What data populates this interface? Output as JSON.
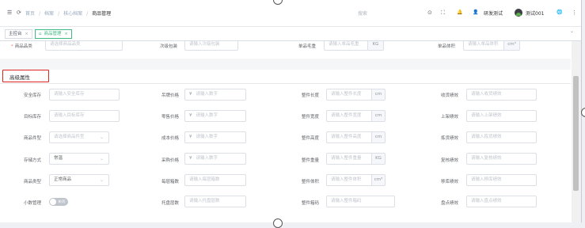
{
  "navbar": {
    "menu_icon": "☰",
    "refresh_icon": "⟳",
    "breadcrumbs": [
      "首页",
      "档案",
      "核心档案",
      "商品管理"
    ],
    "search_placeholder": "搜索",
    "tool_icons": [
      "⊙",
      "⛶",
      "🔔"
    ],
    "user_name": "研发测试",
    "tenant_name": "测试001",
    "globe_icon": "🌐",
    "more_icon": "⋮"
  },
  "tags": {
    "items": [
      {
        "label": "主控台",
        "close": "×"
      },
      {
        "label": "商品管理",
        "close": "×",
        "icon": "⌂"
      }
    ],
    "chevron": "⌄"
  },
  "basic_row": {
    "commodity_type": {
      "label": "商品品类",
      "placeholder": "请选择商品品类"
    },
    "secondary_package": {
      "label": "次级包装",
      "placeholder": "请输入次级包装"
    },
    "gross_weight": {
      "label": "单品毛重",
      "placeholder": "请输入单品毛重",
      "unit": "KG"
    },
    "volume": {
      "label": "单品体积",
      "placeholder": "请输入单品体积",
      "unit": "cm³"
    }
  },
  "section": {
    "title": "高级属性"
  },
  "advanced": {
    "col1": [
      {
        "label": "安全库存",
        "placeholder": "请输入安全库存"
      },
      {
        "label": "目标库存",
        "placeholder": "请输入目标库存"
      },
      {
        "label": "商品件型",
        "placeholder": "请选择商品件型"
      },
      {
        "label": "存储方式",
        "value": "常温"
      },
      {
        "label": "商品类型",
        "value": "正常商品"
      },
      {
        "label": "小数管理",
        "toggle_text": "关闭"
      }
    ],
    "col2": [
      {
        "label": "吊牌价格",
        "placeholder": "请输入数字",
        "prefix": "¥"
      },
      {
        "label": "零售价格",
        "placeholder": "请输入数字",
        "prefix": "¥"
      },
      {
        "label": "成本价格",
        "placeholder": "请输入数字",
        "prefix": "¥"
      },
      {
        "label": "采购价格",
        "placeholder": "请输入数字",
        "prefix": "¥"
      },
      {
        "label": "每层箱数",
        "placeholder": "请输入每层箱数"
      },
      {
        "label": "托盘层数",
        "placeholder": "请输入托盘层数"
      }
    ],
    "col3": [
      {
        "label": "整件长度",
        "placeholder": "请输入整件长度",
        "unit": "cm"
      },
      {
        "label": "整件宽度",
        "placeholder": "请输入整件宽度",
        "unit": "cm"
      },
      {
        "label": "整件高度",
        "placeholder": "请输入整件高度",
        "unit": "cm"
      },
      {
        "label": "整件重量",
        "placeholder": "请输入整件重量",
        "unit": "KG"
      },
      {
        "label": "整件体积",
        "placeholder": "请输入整件体积",
        "unit": "cm³"
      },
      {
        "label": "整件箱码",
        "placeholder": "请输入整件箱码"
      }
    ],
    "col4": [
      {
        "label": "收货绩效",
        "placeholder": "请输入收货绩效"
      },
      {
        "label": "上架绩效",
        "placeholder": "请输入上架绩效"
      },
      {
        "label": "拣货绩效",
        "placeholder": "请输入拣货绩效"
      },
      {
        "label": "复核绩效",
        "placeholder": "请输入复核绩效"
      },
      {
        "label": "移库绩效",
        "placeholder": "请输入移库绩效"
      },
      {
        "label": "盘点绩效",
        "placeholder": "请输入盘点绩效"
      }
    ]
  },
  "colors": {
    "active_tag": "#42b983",
    "highlight_border": "#e02424",
    "required": "#f56c6c"
  }
}
